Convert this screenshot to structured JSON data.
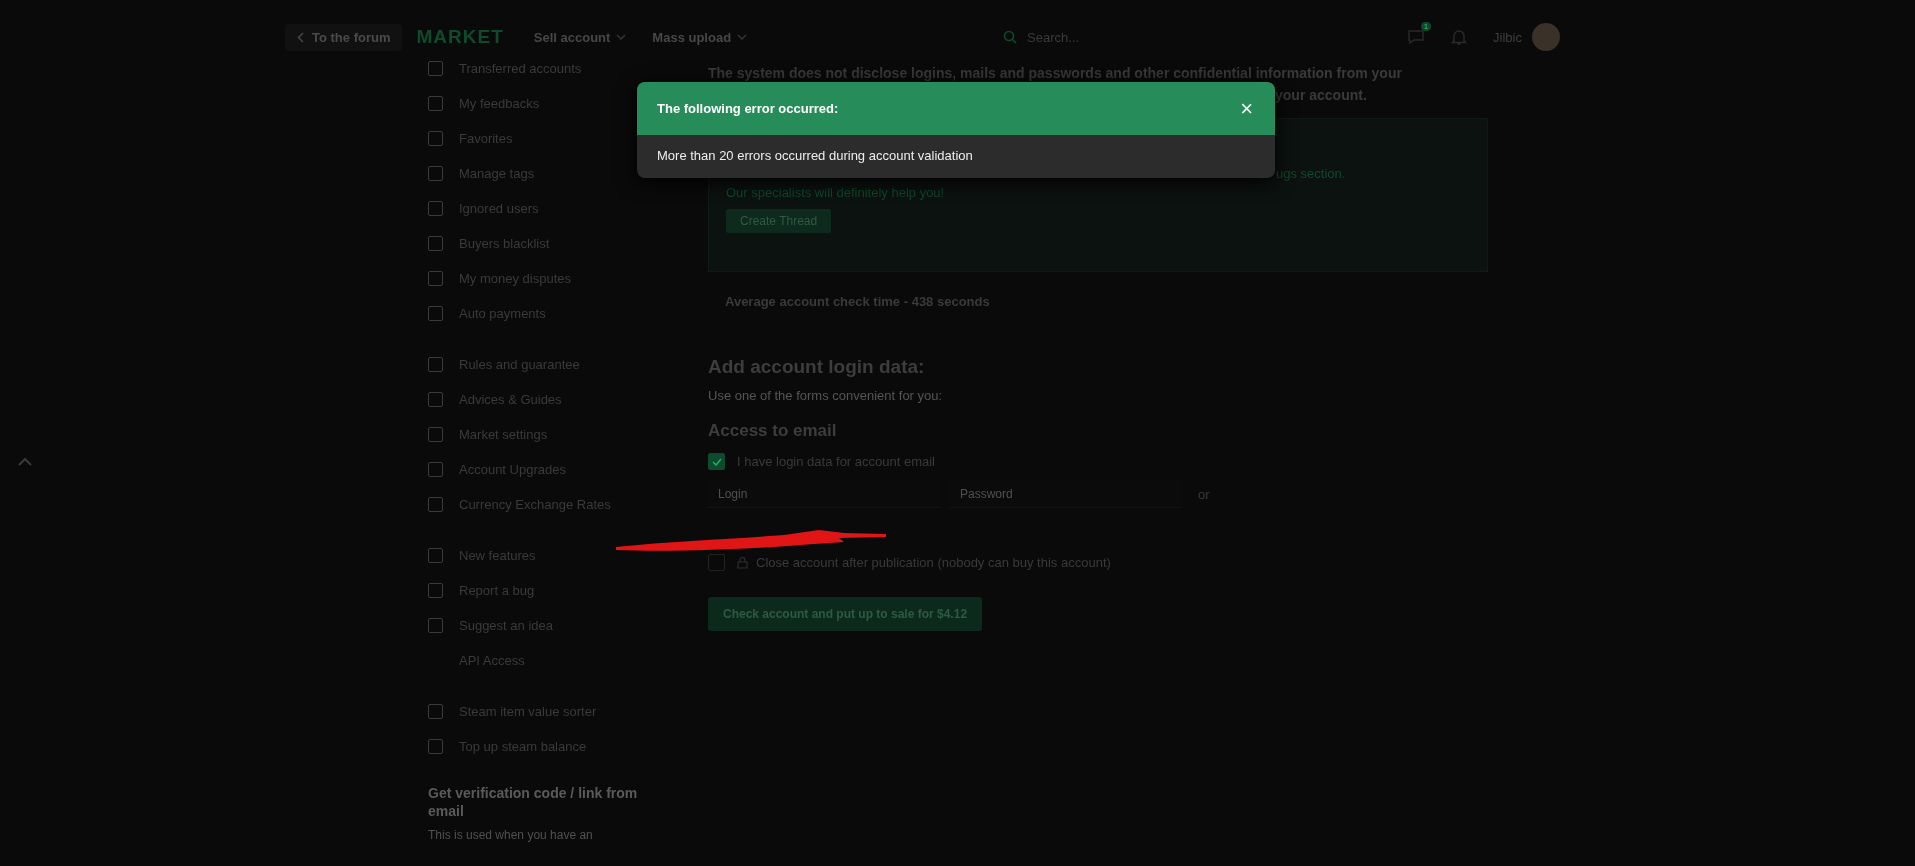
{
  "header": {
    "back_link": "To the forum",
    "logo": "MARKET",
    "menus": [
      {
        "label": "Sell account"
      },
      {
        "label": "Mass upload"
      }
    ],
    "search": {
      "placeholder": "Search..."
    },
    "messages_badge": "1",
    "username": "Jilbic"
  },
  "sidebar": {
    "groups": [
      {
        "items": [
          {
            "label": "Transferred accounts",
            "icon": true
          },
          {
            "label": "My feedbacks",
            "icon": true
          },
          {
            "label": "Favorites",
            "icon": true
          },
          {
            "label": "Manage tags",
            "icon": true
          },
          {
            "label": "Ignored users",
            "icon": true
          },
          {
            "label": "Buyers blacklist",
            "icon": true
          },
          {
            "label": "My money disputes",
            "icon": true
          },
          {
            "label": "Auto payments",
            "icon": true
          }
        ]
      },
      {
        "items": [
          {
            "label": "Rules and guarantee",
            "icon": true
          },
          {
            "label": "Advices & Guides",
            "icon": true
          },
          {
            "label": "Market settings",
            "icon": true
          },
          {
            "label": "Account Upgrades",
            "icon": true
          },
          {
            "label": "Currency Exchange Rates",
            "icon": true
          }
        ]
      },
      {
        "items": [
          {
            "label": "New features",
            "icon": true
          },
          {
            "label": "Report a bug",
            "icon": true
          },
          {
            "label": "Suggest an idea",
            "icon": true
          },
          {
            "label": "API Access",
            "icon": false
          }
        ]
      },
      {
        "items": [
          {
            "label": "Steam item value sorter",
            "icon": true
          },
          {
            "label": "Top up steam balance",
            "icon": true
          }
        ]
      }
    ],
    "verification": {
      "title": "Get verification code / link from email",
      "text": "This is used when you have an"
    }
  },
  "main": {
    "notice_line_1": "The system does not disclose logins, mails and passwords and other confidential information from your",
    "notice_line_2_end": "your account.",
    "help_box": {
      "line_end": "ugs section.",
      "line_2": "Our specialists will definitely help you!",
      "button": "Create Thread"
    },
    "check_time": "Average account check time - 438 seconds",
    "login_title": "Add account login data:",
    "login_hint": "Use one of the forms convenient for you:",
    "email_title": "Access to email",
    "email_checkbox": {
      "label": "I have login data for account email",
      "checked": true
    },
    "fields": [
      {
        "placeholder": "Login"
      },
      {
        "placeholder": "Password"
      }
    ],
    "or": "or",
    "close_checkbox": {
      "label": "Close account after publication (nobody can buy this account)",
      "checked": false
    },
    "submit": "Check account and put up to sale for $4.12"
  },
  "modal": {
    "title": "The following error occurred:",
    "close": "×",
    "message": "More than 20 errors occurred during account validation"
  }
}
